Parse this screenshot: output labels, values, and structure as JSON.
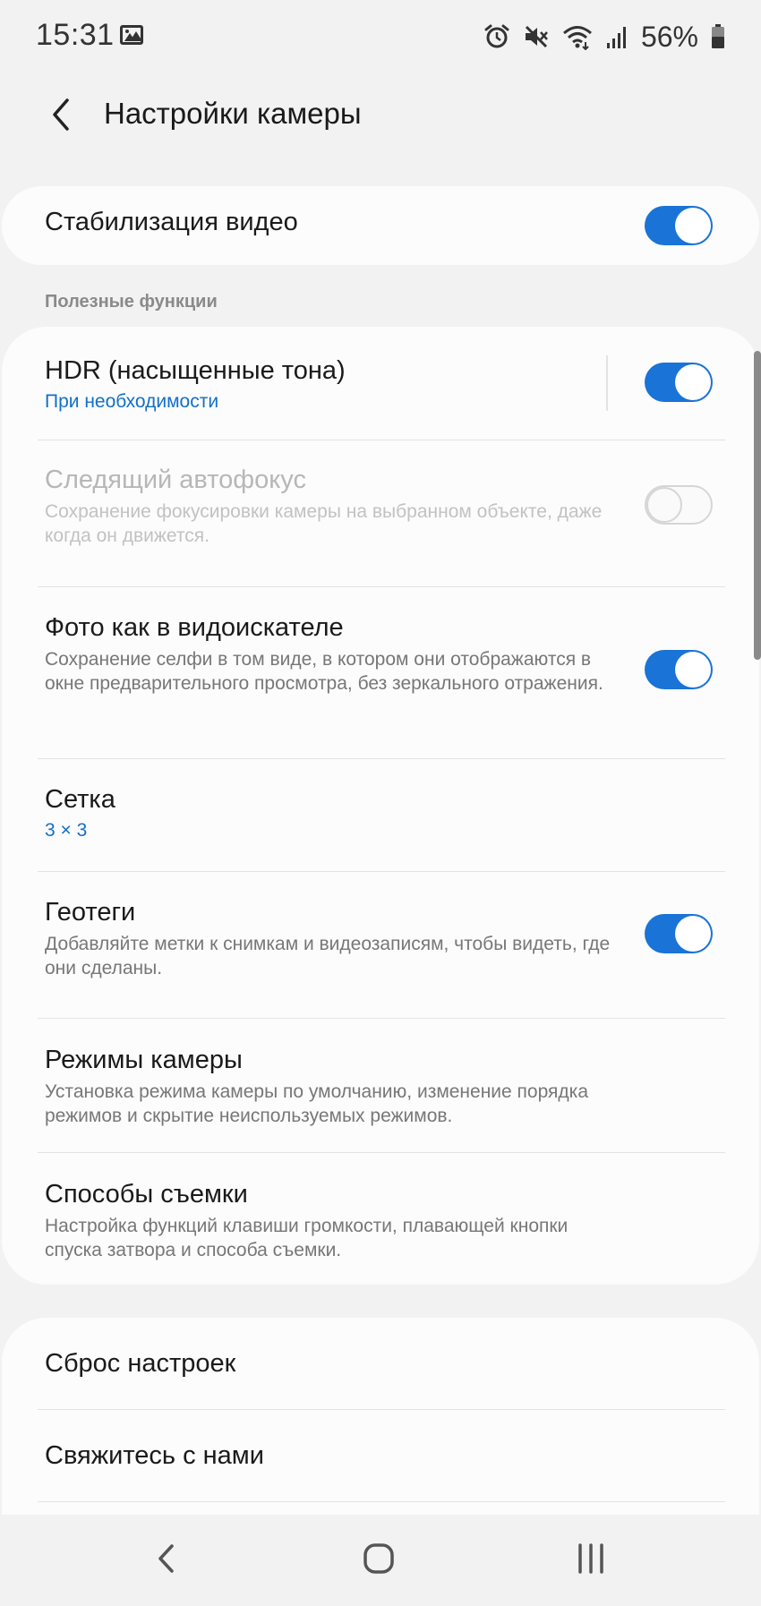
{
  "status_bar": {
    "time": "15:31",
    "battery_percent": "56%",
    "icons": [
      "gallery-icon",
      "alarm-icon",
      "mute-icon",
      "wifi-icon",
      "signal-icon",
      "battery-icon"
    ]
  },
  "header": {
    "title": "Настройки камеры",
    "back_icon": "back-arrow-icon"
  },
  "video_stabilization": {
    "title": "Стабилизация видео",
    "enabled": true
  },
  "section": {
    "title": "Полезные функции"
  },
  "settings": [
    {
      "title": "HDR (насыщенные тона)",
      "subtitle": "При необходимости",
      "subtitle_style": "accent",
      "toggle": true,
      "enabled": true
    },
    {
      "title": "Следящий автофокус",
      "subtitle": "Сохранение фокусировки камеры на выбранном объекте, даже когда он движется.",
      "toggle": false,
      "enabled": false
    },
    {
      "title": "Фото как в видоискателе",
      "subtitle": "Сохранение селфи в том виде, в котором они отображаются в окне предварительного просмотра, без зеркального отражения.",
      "toggle": true,
      "enabled": true
    },
    {
      "title": "Сетка",
      "subtitle": "3 × 3",
      "subtitle_style": "accent"
    },
    {
      "title": "Геотеги",
      "subtitle": "Добавляйте метки к снимкам и видеозаписям, чтобы видеть, где они сделаны.",
      "toggle": true,
      "enabled": true
    },
    {
      "title": "Режимы камеры",
      "subtitle": "Установка режима камеры по умолчанию, изменение порядка режимов и скрытие неиспользуемых режимов."
    },
    {
      "title": "Способы съемки",
      "subtitle": "Настройка функций клавиши громкости, плавающей кнопки спуска затвора и способа съемки."
    }
  ],
  "bottom_items": [
    {
      "title": "Сброс настроек"
    },
    {
      "title": "Свяжитесь с нами"
    }
  ],
  "nav_bar": {
    "buttons": [
      "back-nav-icon",
      "home-nav-icon",
      "recents-nav-icon"
    ]
  },
  "colors": {
    "accent": "#1a73d6",
    "accent_text": "#1170c8",
    "background": "#f2f2f2",
    "card": "#fcfcfc"
  }
}
